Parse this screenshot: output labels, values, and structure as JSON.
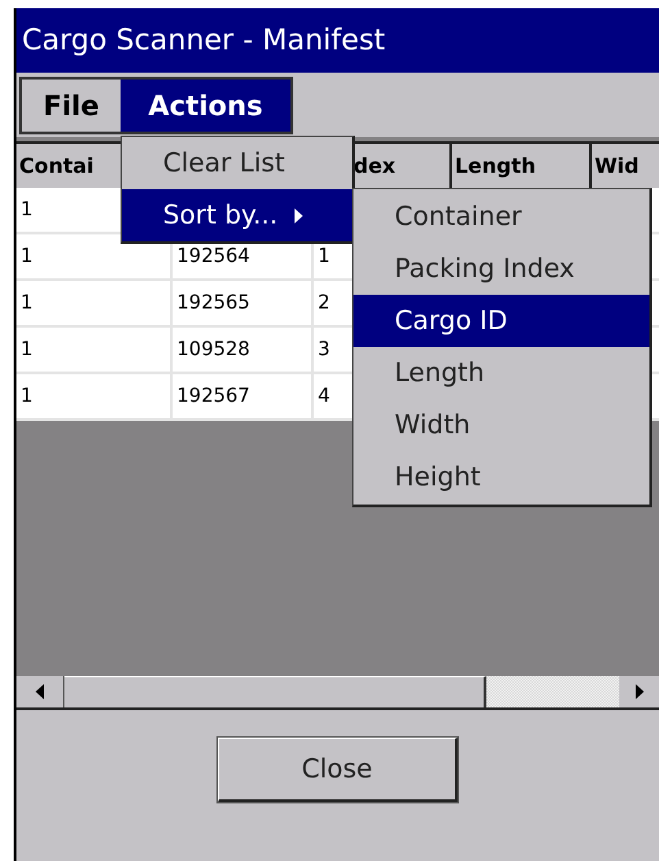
{
  "window": {
    "title": "Cargo Scanner - Manifest"
  },
  "menu_bar": [
    {
      "label": "File",
      "selected": false
    },
    {
      "label": "Actions",
      "selected": true
    }
  ],
  "table": {
    "columns": [
      {
        "label": "Contai"
      },
      {},
      {
        "label": "dex"
      },
      {
        "label": "Length"
      },
      {
        "label": "Wid"
      }
    ],
    "rows": [
      [
        "1",
        null,
        null
      ],
      [
        "1",
        "192564",
        "1"
      ],
      [
        "1",
        "192565",
        "2"
      ],
      [
        "1",
        "109528",
        "3"
      ],
      [
        "1",
        "192567",
        "4"
      ]
    ]
  },
  "actions_menu": {
    "items": [
      {
        "label": "Clear List",
        "selected": false,
        "submenu": false
      },
      {
        "label": "Sort by...",
        "selected": true,
        "submenu": true
      }
    ]
  },
  "sort_menu": {
    "items": [
      {
        "label": "Container",
        "selected": false
      },
      {
        "label": "Packing Index",
        "selected": false
      },
      {
        "label": "Cargo ID",
        "selected": true
      },
      {
        "label": "Length",
        "selected": false
      },
      {
        "label": "Width",
        "selected": false
      },
      {
        "label": "Height",
        "selected": false
      }
    ]
  },
  "close_button": {
    "label": "Close"
  }
}
